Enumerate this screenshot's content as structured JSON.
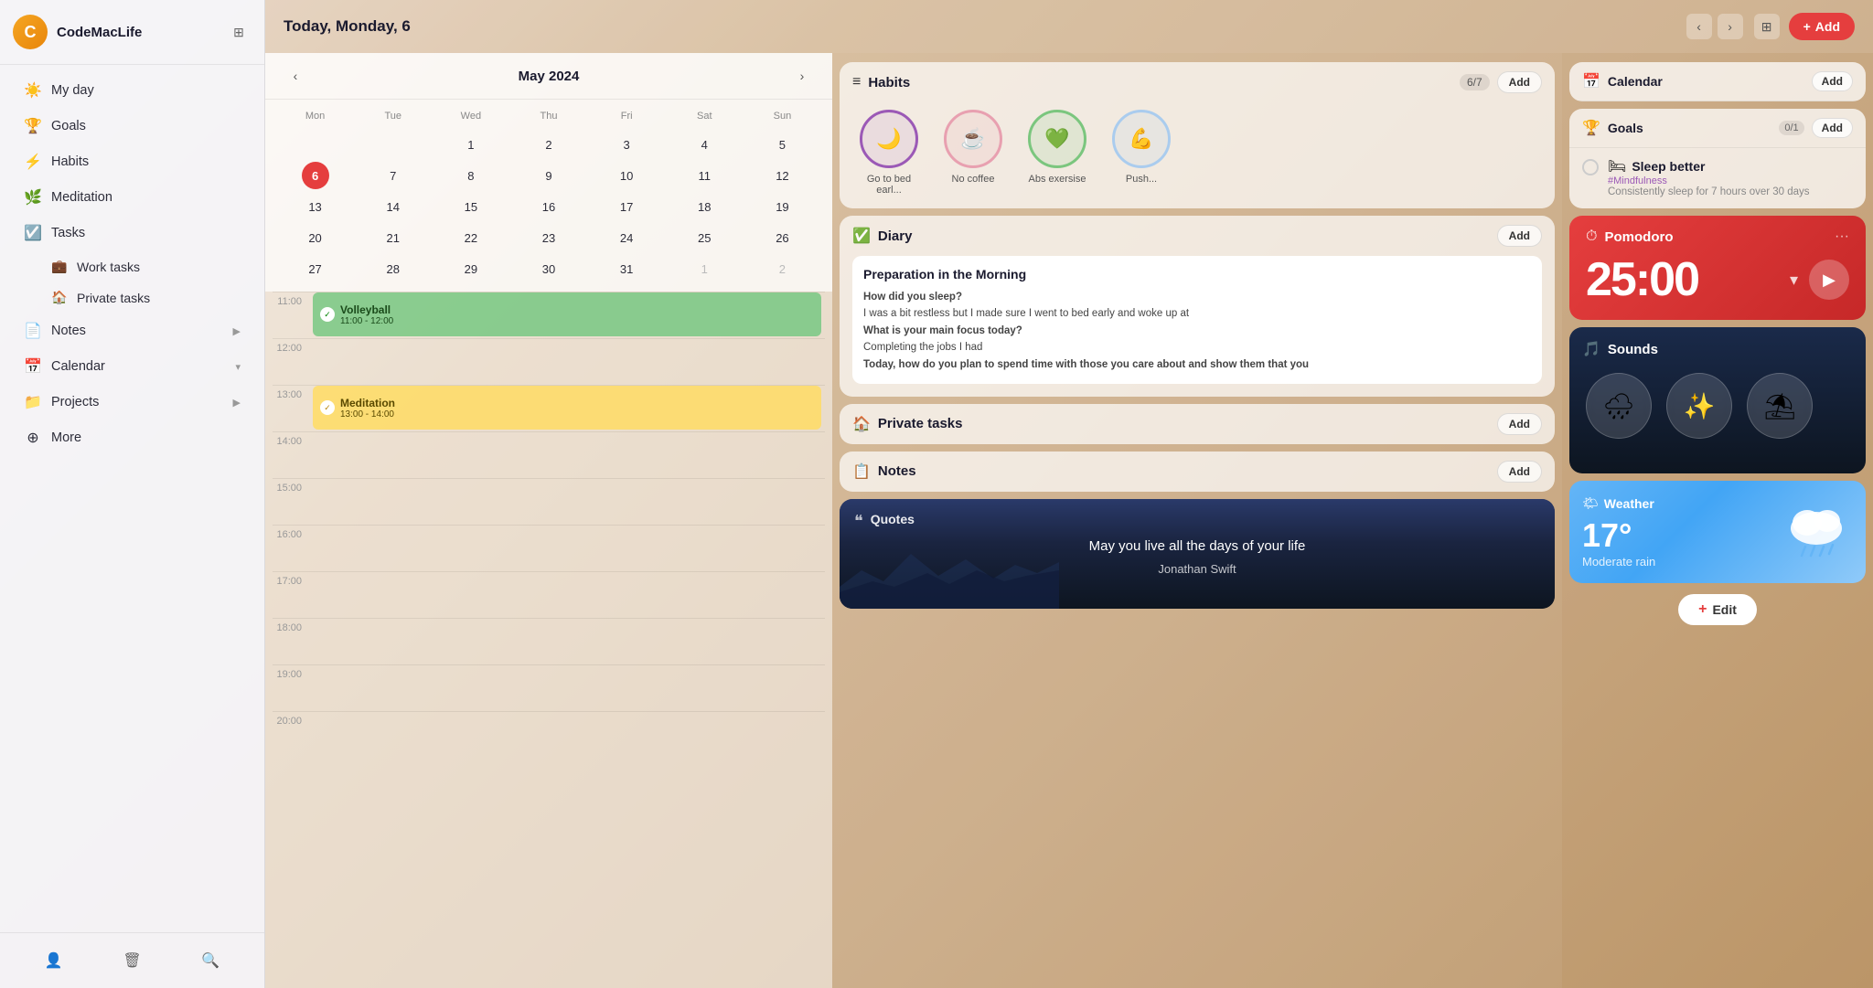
{
  "app": {
    "user": "CodeMacLife",
    "header_date": "Today, Monday, 6"
  },
  "sidebar": {
    "items": [
      {
        "label": "My day",
        "icon": "☀️"
      },
      {
        "label": "Goals",
        "icon": "🏆"
      },
      {
        "label": "Habits",
        "icon": "⚡"
      },
      {
        "label": "Meditation",
        "icon": "🌿"
      },
      {
        "label": "Tasks",
        "icon": "☑️"
      },
      {
        "label": "Work tasks",
        "icon": "💼"
      },
      {
        "label": "Private tasks",
        "icon": "🏠"
      },
      {
        "label": "Notes",
        "icon": "📄"
      },
      {
        "label": "Calendar",
        "icon": "📅"
      },
      {
        "label": "Projects",
        "icon": "📁"
      },
      {
        "label": "More",
        "icon": "⊕"
      }
    ],
    "footer": {
      "user_icon": "👤",
      "trash_icon": "🗑",
      "search_icon": "🔍"
    }
  },
  "calendar": {
    "month": "May 2024",
    "days_header": [
      "Mon",
      "Tue",
      "Wed",
      "Thu",
      "Fri",
      "Sat",
      "Sun"
    ],
    "days": [
      {
        "day": "",
        "type": "empty"
      },
      {
        "day": "",
        "type": "empty"
      },
      {
        "day": "1"
      },
      {
        "day": "2"
      },
      {
        "day": "3"
      },
      {
        "day": "4"
      },
      {
        "day": "5"
      },
      {
        "day": "6",
        "type": "today"
      },
      {
        "day": "7"
      },
      {
        "day": "8"
      },
      {
        "day": "9"
      },
      {
        "day": "10"
      },
      {
        "day": "11"
      },
      {
        "day": "12"
      },
      {
        "day": "13"
      },
      {
        "day": "14"
      },
      {
        "day": "15"
      },
      {
        "day": "16"
      },
      {
        "day": "17"
      },
      {
        "day": "18"
      },
      {
        "day": "19"
      },
      {
        "day": "20"
      },
      {
        "day": "21"
      },
      {
        "day": "22"
      },
      {
        "day": "23"
      },
      {
        "day": "24"
      },
      {
        "day": "25"
      },
      {
        "day": "26"
      },
      {
        "day": "27"
      },
      {
        "day": "28"
      },
      {
        "day": "29"
      },
      {
        "day": "30"
      },
      {
        "day": "31"
      },
      {
        "day": "1",
        "type": "other"
      },
      {
        "day": "2",
        "type": "other"
      }
    ],
    "events": [
      {
        "name": "Volleyball",
        "time": "11:00 - 12:00",
        "type": "green",
        "slot": "11:00"
      },
      {
        "name": "Meditation",
        "time": "13:00 - 14:00",
        "type": "yellow",
        "slot": "13:00"
      }
    ],
    "time_slots": [
      "11:00",
      "12:00",
      "13:00",
      "14:00",
      "15:00",
      "16:00",
      "17:00",
      "18:00",
      "19:00",
      "20:00"
    ]
  },
  "habits_widget": {
    "title": "Habits",
    "badge": "6/7",
    "add_label": "Add",
    "items": [
      {
        "label": "Go to bed earl...",
        "icon": "🌙",
        "color": "purple"
      },
      {
        "label": "No coffee",
        "icon": "☕",
        "color": "pink"
      },
      {
        "label": "Abs exersise",
        "icon": "💚",
        "color": "green"
      },
      {
        "label": "Push...",
        "icon": "💪",
        "color": "blue"
      }
    ]
  },
  "diary_widget": {
    "title": "Diary",
    "add_label": "Add",
    "card_title": "Preparation in the Morning",
    "questions": [
      {
        "q": "How did you sleep?",
        "a": "I was a bit restless but I made sure I went to bed early and woke up at"
      },
      {
        "q": "What is your main focus today?",
        "a": "Completing the jobs I had"
      },
      {
        "q": "Today, how do you plan to spend time with those you care about and show them that you"
      }
    ]
  },
  "private_tasks_widget": {
    "title": "Private tasks",
    "add_label": "Add"
  },
  "notes_widget": {
    "title": "Notes",
    "add_label": "Add"
  },
  "quotes_widget": {
    "title": "Quotes",
    "icon": "❝",
    "quote": "May you live all the days of your life",
    "author": "Jonathan Swift"
  },
  "right_panel": {
    "calendar_widget": {
      "title": "Calendar",
      "add_label": "Add",
      "icon": "📅"
    },
    "goals_widget": {
      "title": "Goals",
      "badge": "0/1",
      "add_label": "Add",
      "icon": "🏆",
      "items": [
        {
          "name": "Sleep better",
          "tag": "#Mindfulness",
          "desc": "Consistently sleep for 7 hours over 30 days",
          "icon": "🛏"
        }
      ]
    },
    "pomodoro_widget": {
      "title": "Pomodoro",
      "icon": "⏱",
      "time": "25:00"
    },
    "sounds_widget": {
      "title": "Sounds",
      "icon": "🎵",
      "sounds": [
        {
          "icon": "🌧",
          "label": "Rain"
        },
        {
          "icon": "✨",
          "label": "Magic"
        },
        {
          "icon": "⛱",
          "label": "Beach"
        }
      ]
    },
    "weather_widget": {
      "title": "Weather",
      "icon": "🌤",
      "temp": "17°",
      "desc": "Moderate rain"
    },
    "edit_btn": "Edit"
  }
}
